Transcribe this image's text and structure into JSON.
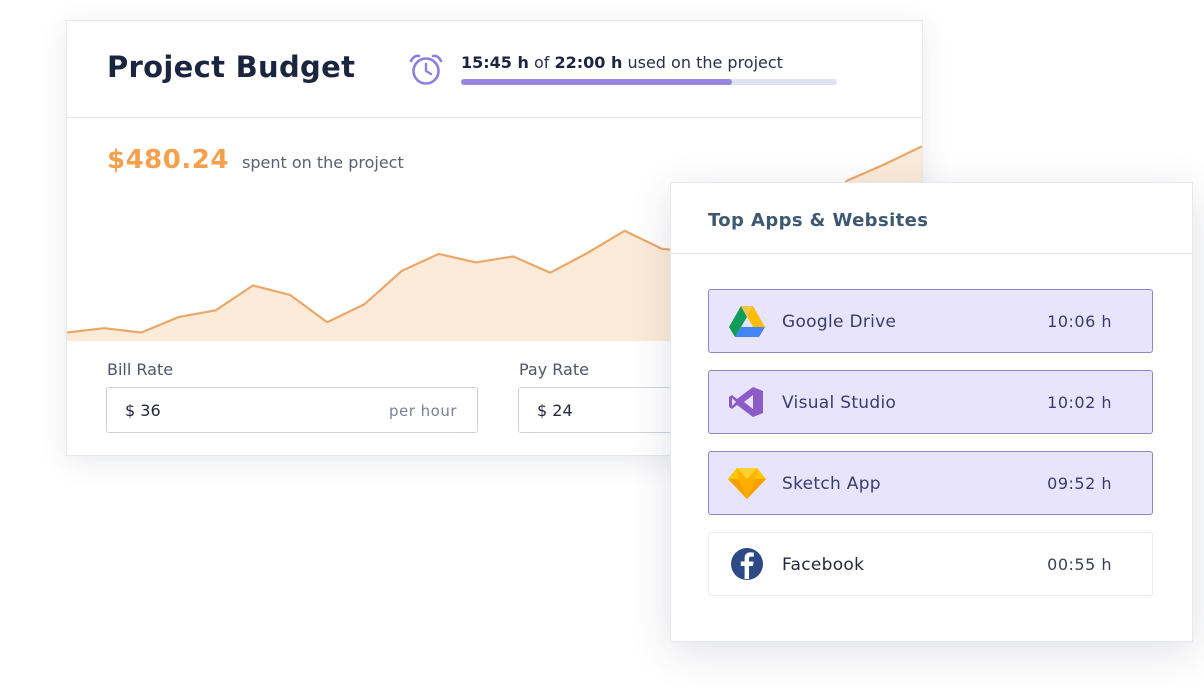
{
  "budget": {
    "title": "Project Budget",
    "hours_used": "15:45 h",
    "hours_of": "of",
    "hours_total": "22:00 h",
    "hours_suffix": "used on the project",
    "hours_fraction": 0.72,
    "spent_amount": "$480.24",
    "spent_label": "spent on the project",
    "bill_rate": {
      "label": "Bill Rate",
      "value": "$ 36",
      "suffix": "per hour"
    },
    "pay_rate": {
      "label": "Pay Rate",
      "value": "$ 24"
    }
  },
  "chart_data": {
    "type": "area",
    "values": [
      1,
      1.5,
      1,
      2.8,
      3.6,
      6.5,
      5.4,
      2.2,
      4.3,
      8.2,
      10.2,
      9.2,
      9.9,
      8,
      10.3,
      12.9,
      10.8,
      10.4,
      11.3,
      13,
      15,
      18.8,
      20.7,
      22.8
    ],
    "ylim": [
      0,
      24
    ],
    "fill_color": "#fdebd9",
    "line_color": "#e9a869"
  },
  "apps": {
    "title": "Top Apps & Websites",
    "items": [
      {
        "name": "Google Drive",
        "time": "10:06 h",
        "icon": "google-drive-icon",
        "highlighted": true
      },
      {
        "name": "Visual Studio",
        "time": "10:02 h",
        "icon": "visual-studio-icon",
        "highlighted": true
      },
      {
        "name": "Sketch App",
        "time": "09:52 h",
        "icon": "sketch-icon",
        "highlighted": true
      },
      {
        "name": "Facebook",
        "time": "00:55 h",
        "icon": "facebook-icon",
        "highlighted": false
      }
    ]
  },
  "colors": {
    "accent_purple": "#9787e3",
    "spent_orange": "#f5a04d",
    "highlight_row": "#e7e4fb"
  }
}
